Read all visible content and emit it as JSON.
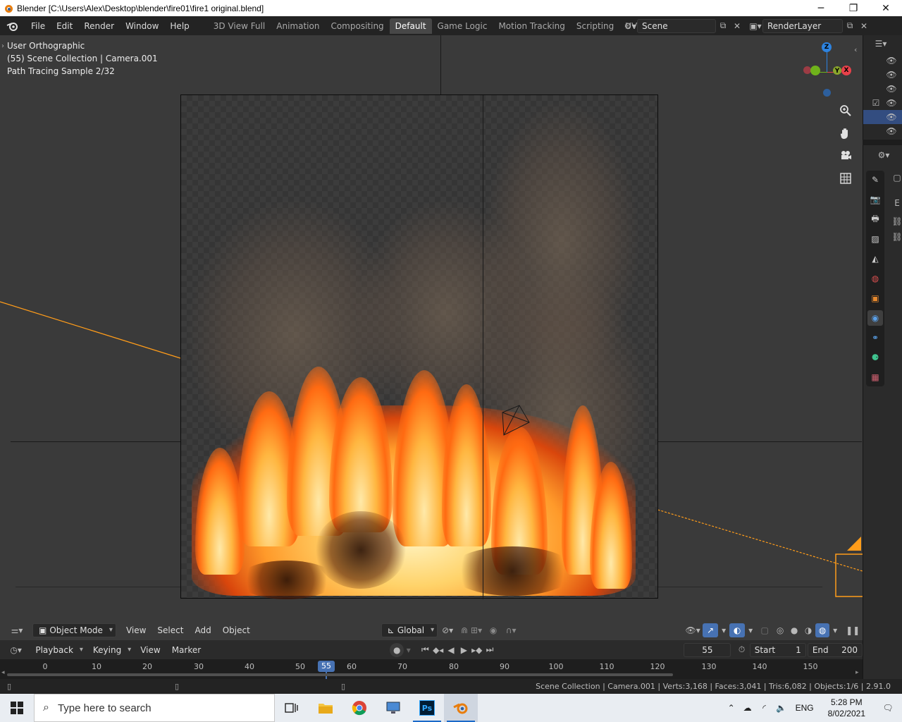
{
  "window": {
    "title": "Blender [C:\\Users\\Alex\\Desktop\\blender\\fire01\\fire1 original.blend]",
    "minimize": "─",
    "maximize": "❐",
    "close": "✕"
  },
  "topbar": {
    "menus": [
      "File",
      "Edit",
      "Render",
      "Window",
      "Help"
    ],
    "workspaces": [
      "3D View Full",
      "Animation",
      "Compositing",
      "Default",
      "Game Logic",
      "Motion Tracking",
      "Scripting",
      "UV Editing",
      "V"
    ],
    "active_workspace": "Default",
    "scene": "Scene",
    "render_layer": "RenderLayer"
  },
  "viewport": {
    "view_name": "User Orthographic",
    "collection_info": "(55) Scene Collection | Camera.001",
    "render_status": "Path Tracing Sample 2/32",
    "gizmo_axes": {
      "z": "Z",
      "y": "Y",
      "x": "X"
    },
    "colors": {
      "x_axis": "#e8414a",
      "y_axis": "#6fb21b",
      "z_axis": "#2d83e0",
      "selection": "#ff9c1a"
    }
  },
  "viewport_header": {
    "mode": "Object Mode",
    "menus": [
      "View",
      "Select",
      "Add",
      "Object"
    ],
    "orientation": "Global"
  },
  "timeline": {
    "menus": [
      "Playback",
      "Keying",
      "View",
      "Marker"
    ],
    "current_frame": "55",
    "start_label": "Start",
    "start_value": "1",
    "end_label": "End",
    "end_value": "200",
    "ticks": [
      "0",
      "10",
      "20",
      "30",
      "40",
      "50",
      "60",
      "70",
      "80",
      "90",
      "100",
      "110",
      "120",
      "130",
      "140",
      "150"
    ]
  },
  "statusbar": {
    "stats": "Scene Collection | Camera.001 | Verts:3,168 | Faces:3,041 | Tris:6,082 | Objects:1/6 | 2.91.0"
  },
  "taskbar": {
    "search_placeholder": "Type here to search",
    "language": "ENG",
    "time": "5:28 PM",
    "date": "8/02/2021",
    "ps_label": "Ps"
  }
}
